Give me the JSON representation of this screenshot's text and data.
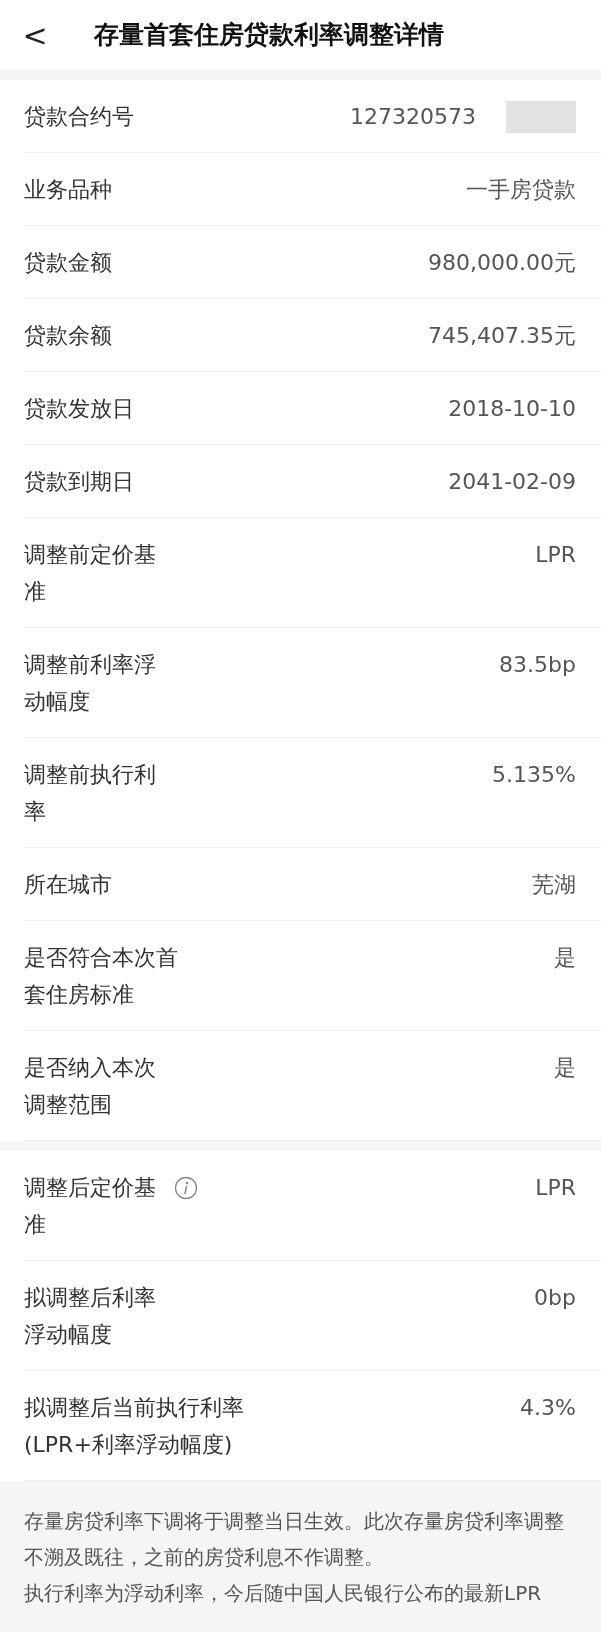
{
  "header": {
    "back": "<",
    "title": "存量首套住房贷款利率调整详情"
  },
  "sections": [
    {
      "rows": [
        {
          "label": "贷款合约号",
          "value": "127320573",
          "redacted": true
        },
        {
          "label": "业务品种",
          "value": "一手房贷款"
        },
        {
          "label": "贷款金额",
          "value": "980,000.00元"
        },
        {
          "label": "贷款余额",
          "value": "745,407.35元"
        },
        {
          "label": "贷款发放日",
          "value": "2018-10-10"
        },
        {
          "label": "贷款到期日",
          "value": "2041-02-09"
        },
        {
          "label": "调整前定价基准",
          "value": "LPR"
        },
        {
          "label": "调整前利率浮动幅度",
          "value": "83.5bp"
        },
        {
          "label": "调整前执行利率",
          "value": "5.135%"
        },
        {
          "label": "所在城市",
          "value": "芜湖"
        },
        {
          "label": "是否符合本次首套住房标准",
          "value": "是"
        },
        {
          "label": "是否纳入本次调整范围",
          "value": "是"
        }
      ]
    },
    {
      "rows": [
        {
          "label": "调整后定价基准",
          "value": "LPR",
          "info": true
        },
        {
          "label": "拟调整后利率浮动幅度",
          "value": "0bp"
        },
        {
          "label": "拟调整后当前执行利率\n(LPR+利率浮动幅度)",
          "value": "4.3%"
        }
      ]
    }
  ],
  "notes": [
    "存量房贷利率下调将于调整当日生效。此次存量房贷利率调整不溯及既往，之前的房贷利息不作调整。",
    "执行利率为浮动利率，今后随中国人民银行公布的最新LPR"
  ]
}
